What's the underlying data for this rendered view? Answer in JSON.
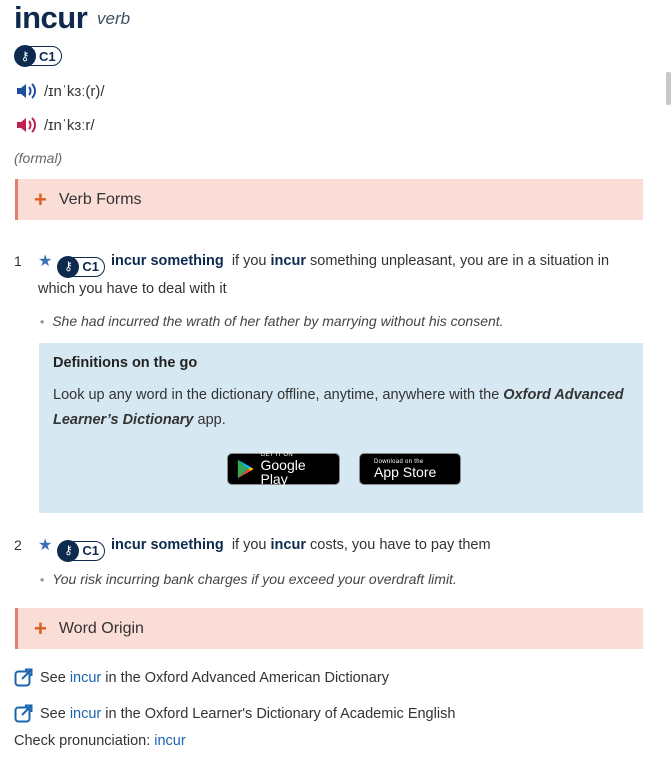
{
  "entry": {
    "headword": "incur",
    "pos": "verb",
    "level": "C1",
    "pron_uk": "/ɪnˈkɜː(r)/",
    "pron_us": "/ɪnˈkɜːr/",
    "register": "(formal)"
  },
  "verb_forms": {
    "label": "Verb Forms"
  },
  "senses": [
    {
      "num": "1",
      "level": "C1",
      "grammar": "incur something",
      "def_prefix": "if you",
      "def_keyword": "incur",
      "def_rest": "something unpleasant, you are in a situation in which you have to deal with it",
      "example": "She had incurred the wrath of her father by marrying without his consent."
    },
    {
      "num": "2",
      "level": "C1",
      "grammar": "incur something",
      "def_prefix": "if you",
      "def_keyword": "incur",
      "def_rest": "costs, you have to pay them",
      "example": "You risk incurring bank charges if you exceed your overdraft limit."
    }
  ],
  "promo": {
    "title": "Definitions on the go",
    "text_before": "Look up any word in the dictionary offline, anytime, anywhere with the",
    "app_name": "Oxford Advanced Learner’s Dictionary",
    "text_after": "app.",
    "google_small": "GET IT ON",
    "google_big": "Google Play",
    "apple_small": "Download on the",
    "apple_big": "App Store"
  },
  "word_origin": {
    "label": "Word Origin"
  },
  "links": [
    {
      "prefix": "See",
      "word": "incur",
      "suffix": "in the Oxford Advanced American Dictionary"
    },
    {
      "prefix": "See",
      "word": "incur",
      "suffix": "in the Oxford Learner's Dictionary of Academic English"
    }
  ],
  "check": {
    "label": "Check pronunciation:",
    "word": "incur"
  },
  "colors": {
    "navy": "#0e2a4f",
    "link": "#1a64b0",
    "accent": "#d9601e",
    "bar_bg": "#fbddd8",
    "promo_bg": "#d6e8f2"
  }
}
